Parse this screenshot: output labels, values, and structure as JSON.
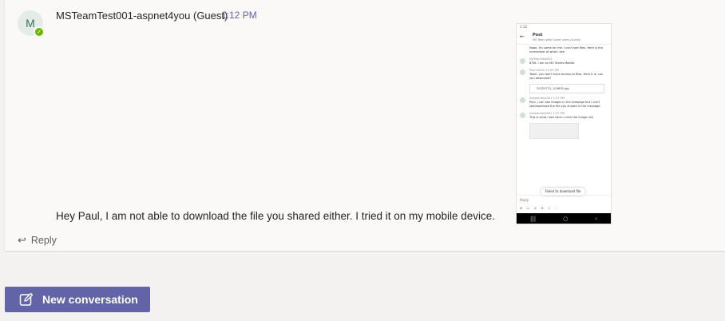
{
  "message": {
    "avatar_initial": "M",
    "presence": "available",
    "author": "MSTeamTest001-aspnet4you (Guest)",
    "time": "1:12 PM",
    "text": "Hey Paul, I am not able to download the file you shared either. I tried it on my mobile device.",
    "reply_label": "Reply"
  },
  "screenshot": {
    "status": "1:12",
    "header_title": "Post",
    "header_subtitle": "MS Team with Guest users (Guest)",
    "items": [
      {
        "name": "",
        "text": "Nope, it's same for me. I can't see files. Here is the screenshot of what I see"
      },
      {
        "name": "MSTeamTest001",
        "text": "BTW- I am on MS Teams Mobile."
      },
      {
        "name": "Paul Smith  12:09 PM",
        "text": "Team- you don't have access to files. Here it is, can you download?"
      },
      {
        "name": "msteamtest001  1:07 PM",
        "text": "Paul- I can see images in the message but I can't see/download the file you shared in the message."
      },
      {
        "name": "msteamtest001  1:07 PM",
        "text": "This is what I see when I click the image link"
      }
    ],
    "file_name": "20220712_104835.jpg",
    "toast": "Failed to download file",
    "reply_placeholder": "Reply"
  },
  "footer": {
    "new_conversation_label": "New conversation"
  }
}
